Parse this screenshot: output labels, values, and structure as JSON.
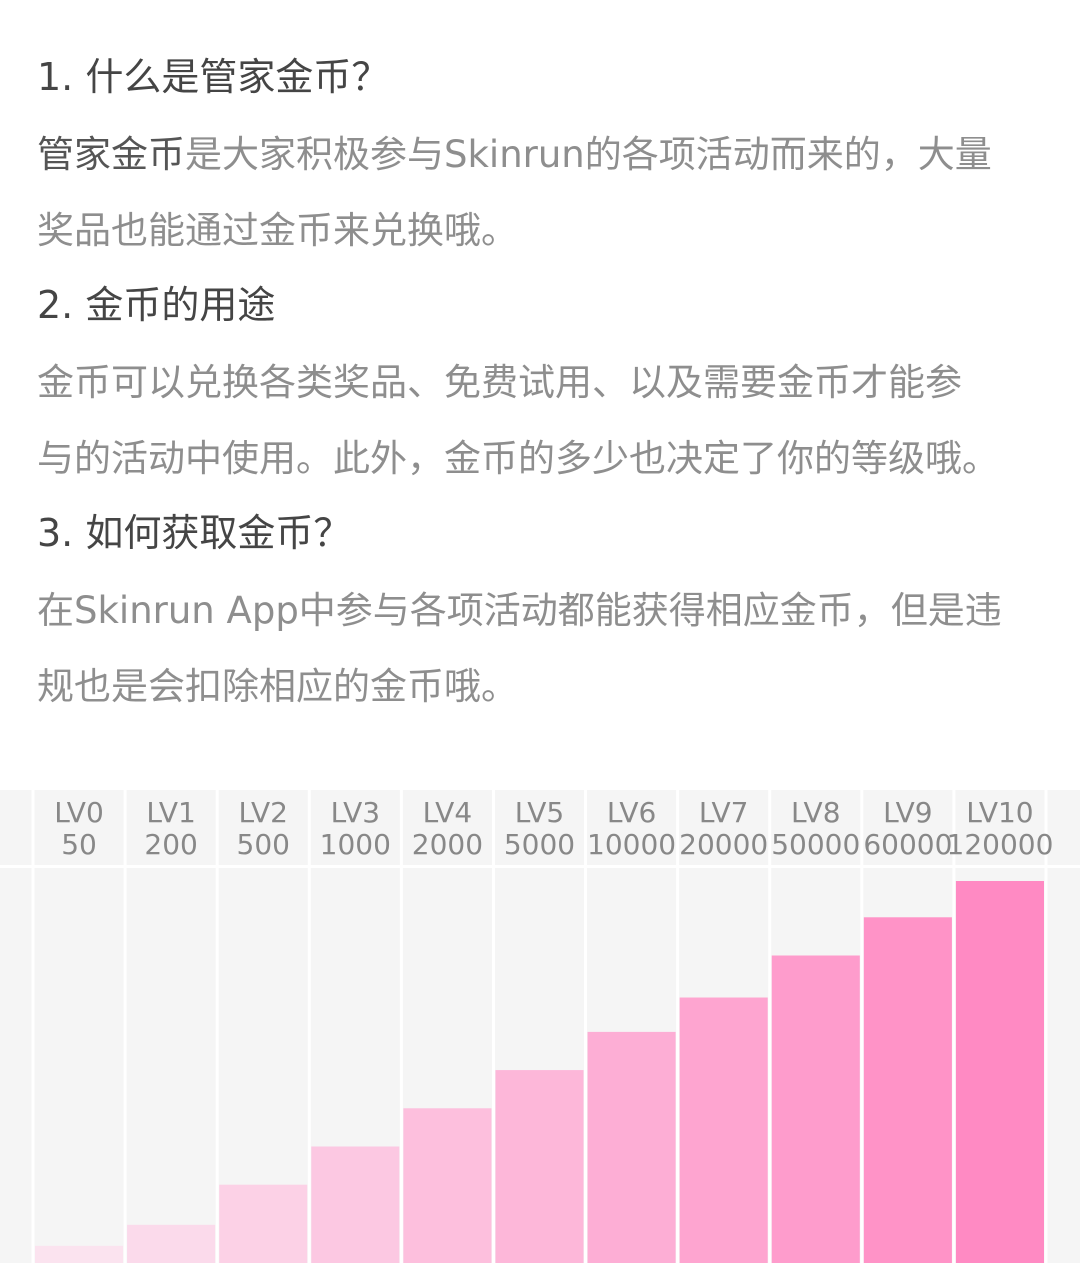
{
  "sections": [
    {
      "heading": "1. 什么是管家金币？",
      "lines": [
        {
          "strong": "管家金币",
          "text": "是大家积极参与Skinrun的各项活动而来的，大量"
        },
        {
          "strong": "",
          "text": "奖品也能通过金币来兑换哦。"
        }
      ]
    },
    {
      "heading": "2. 金币的用途",
      "lines": [
        {
          "strong": "",
          "text": "金币可以兑换各类奖品、免费试用、以及需要金币才能参"
        },
        {
          "strong": "",
          "text": "与的活动中使用。此外，金币的多少也决定了你的等级哦。"
        }
      ]
    },
    {
      "heading": "3. 如何获取金币？",
      "lines": [
        {
          "strong": "",
          "text": "在Skinrun App中参与各项活动都能获得相应金币，但是违"
        },
        {
          "strong": "",
          "text": "规也是会扣除相应的金币哦。"
        }
      ]
    }
  ],
  "colors": {
    "bar_start": "#fbe3ef",
    "bar_end": "#ff8ac3",
    "grid_bg": "#f5f5f5",
    "divider": "#ffffff"
  },
  "chart_data": {
    "type": "bar",
    "categories": [
      "LV0",
      "LV1",
      "LV2",
      "LV3",
      "LV4",
      "LV5",
      "LV6",
      "LV7",
      "LV8",
      "LV9",
      "LV10"
    ],
    "values": [
      50,
      200,
      500,
      1000,
      2000,
      5000,
      10000,
      20000,
      50000,
      60000,
      120000
    ],
    "scale": "ordinal-rank",
    "bar_heights_relative": [
      0.045,
      0.1,
      0.205,
      0.305,
      0.405,
      0.505,
      0.605,
      0.695,
      0.805,
      0.905,
      1.0
    ],
    "title": "",
    "xlabel": "",
    "ylabel": "",
    "grid": true
  }
}
